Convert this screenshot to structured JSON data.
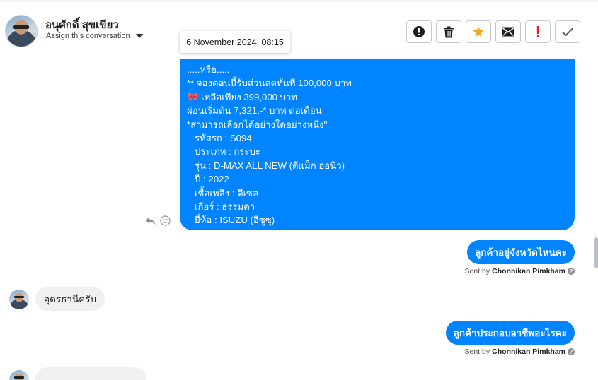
{
  "header": {
    "contact_name": "อนุศักดิ์ สุขเขียว",
    "assign_label": "Assign this conversation",
    "tooltip_time": "6 November 2024, 08:15",
    "actions": [
      {
        "icon": "alert-circle-icon",
        "color": "#1c1e21"
      },
      {
        "icon": "trash-icon",
        "color": "#1c1e21"
      },
      {
        "icon": "star-icon",
        "color": "#f5a623"
      },
      {
        "icon": "envelope-icon",
        "color": "#1c1e21"
      },
      {
        "icon": "exclamation-icon",
        "color": "#e02020"
      },
      {
        "icon": "check-icon",
        "color": "#444444"
      }
    ]
  },
  "messages": {
    "big_outgoing": {
      "lines": [
        ".....หรือ.....",
        "** จองตอนนี้รับส่วนลดทันที 100,000 บาท",
        "เหลือเพียง 399,000 บาท",
        "ผ่อนเริ่มต้น 7,321.-* บาท ต่อเดือน",
        "*สามารถเลือกได้อย่างใดอย่างหนึ่ง\"",
        "   รหัสรถ : S094",
        "   ประเภท : กระบะ",
        "   รุ่น : D-MAX ALL NEW (ดีแม็ก ออนิว)",
        "   ปี : 2022",
        "   เชื้อเพลิง : ดีเซล",
        "   เกียร์ : ธรรมดา",
        "   ยี่ห้อ : ISUZU (อีซูซุ)"
      ],
      "ribbon_glyph": "🎀"
    },
    "out1": {
      "text": "ลูกค้าอยู่จังหวัดไหนคะ",
      "sent_prefix": "Sent by",
      "sender": "Chonnikan Pimkham"
    },
    "in1": {
      "text": "อุดรธานีครับ"
    },
    "out2": {
      "text": "ลูกค้าประกอบอาชีพอะไรคะ",
      "sent_prefix": "Sent by",
      "sender": "Chonnikan Pimkham"
    }
  },
  "colors": {
    "outgoing_bubble": "#0084ff",
    "incoming_bubble": "#f0f0f0"
  }
}
